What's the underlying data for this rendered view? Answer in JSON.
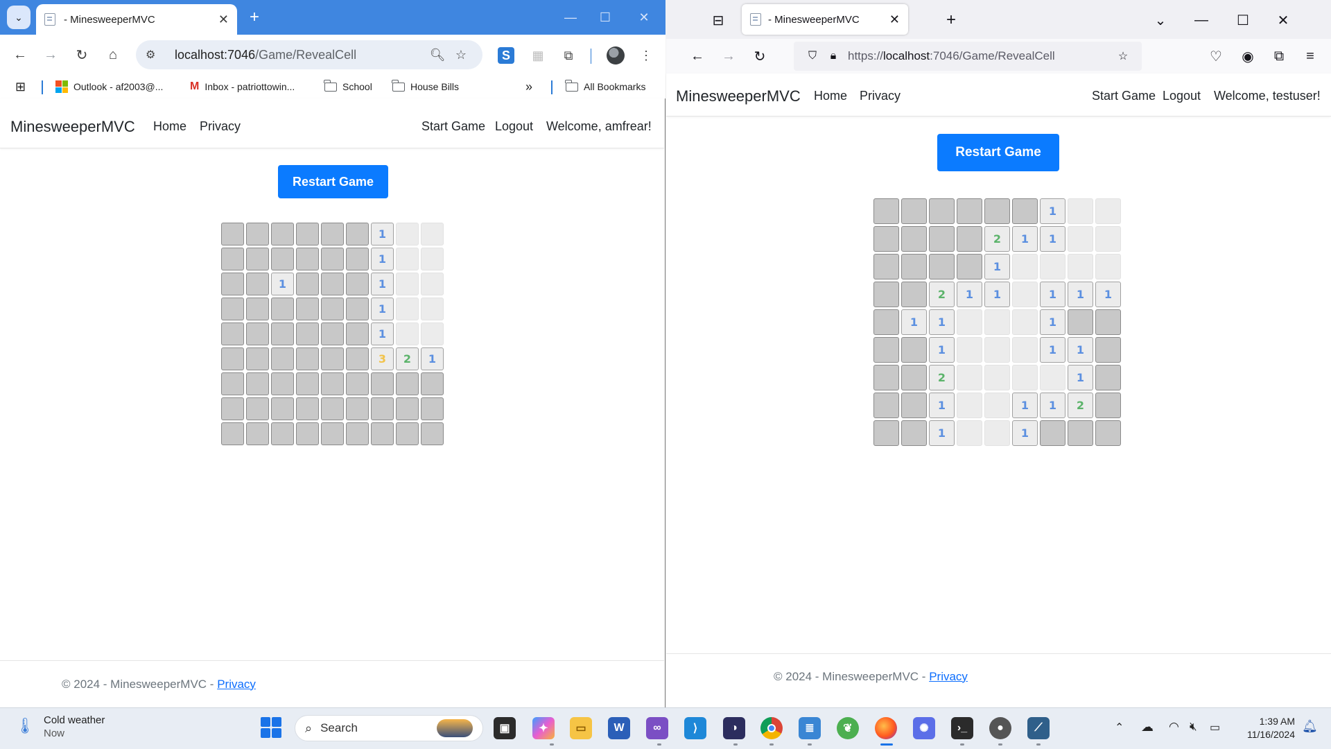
{
  "chrome": {
    "tab_title": "- MinesweeperMVC",
    "url_host": "localhost:7046",
    "url_path": "/Game/RevealCell",
    "bookmarks": [
      "Outlook - af2003@...",
      "Inbox - patriottowin...",
      "School",
      "House Bills",
      "All Bookmarks"
    ],
    "navbar": {
      "brand": "MinesweeperMVC",
      "home": "Home",
      "privacy": "Privacy",
      "start": "Start Game",
      "logout": "Logout",
      "welcome": "Welcome, amfrear!"
    },
    "restart_label": "Restart Game",
    "footer_text": "© 2024 - MinesweeperMVC - ",
    "footer_link": "Privacy",
    "board": [
      [
        "U",
        "U",
        "U",
        "U",
        "U",
        "U",
        "1",
        "R",
        "R"
      ],
      [
        "U",
        "U",
        "U",
        "U",
        "U",
        "U",
        "1",
        "R",
        "R"
      ],
      [
        "U",
        "U",
        "1",
        "U",
        "U",
        "U",
        "1",
        "R",
        "R"
      ],
      [
        "U",
        "U",
        "U",
        "U",
        "U",
        "U",
        "1",
        "R",
        "R"
      ],
      [
        "U",
        "U",
        "U",
        "U",
        "U",
        "U",
        "1",
        "R",
        "R"
      ],
      [
        "U",
        "U",
        "U",
        "U",
        "U",
        "U",
        "3",
        "2",
        "1"
      ],
      [
        "U",
        "U",
        "U",
        "U",
        "U",
        "U",
        "U",
        "U",
        "U"
      ],
      [
        "U",
        "U",
        "U",
        "U",
        "U",
        "U",
        "U",
        "U",
        "U"
      ],
      [
        "U",
        "U",
        "U",
        "U",
        "U",
        "U",
        "U",
        "U",
        "U"
      ]
    ]
  },
  "firefox": {
    "tab_title": "- MinesweeperMVC",
    "url_prefix": "https://",
    "url_host": "localhost",
    "url_rest": ":7046/Game/RevealCell",
    "navbar": {
      "brand": "MinesweeperMVC",
      "home": "Home",
      "privacy": "Privacy",
      "start": "Start Game",
      "logout": "Logout",
      "welcome": "Welcome, testuser!"
    },
    "restart_label": "Restart Game",
    "footer_text": "© 2024 - MinesweeperMVC - ",
    "footer_link": "Privacy",
    "board": [
      [
        "U",
        "U",
        "U",
        "U",
        "U",
        "U",
        "1",
        "R",
        "R"
      ],
      [
        "U",
        "U",
        "U",
        "U",
        "2",
        "1",
        "1",
        "R",
        "R"
      ],
      [
        "U",
        "U",
        "U",
        "U",
        "1",
        "R",
        "R",
        "R",
        "R"
      ],
      [
        "U",
        "U",
        "2",
        "1",
        "1",
        "R",
        "1",
        "1",
        "1"
      ],
      [
        "U",
        "1",
        "1",
        "R",
        "R",
        "R",
        "1",
        "U",
        "U"
      ],
      [
        "U",
        "U",
        "1",
        "R",
        "R",
        "R",
        "1",
        "1",
        "U"
      ],
      [
        "U",
        "U",
        "2",
        "R",
        "R",
        "R",
        "R",
        "1",
        "U"
      ],
      [
        "U",
        "U",
        "1",
        "R",
        "R",
        "1",
        "1",
        "2",
        "U"
      ],
      [
        "U",
        "U",
        "1",
        "R",
        "R",
        "1",
        "U",
        "U",
        "U"
      ]
    ]
  },
  "taskbar": {
    "weather_title": "Cold weather",
    "weather_sub": "Now",
    "search_placeholder": "Search",
    "time": "1:39 AM",
    "date": "11/16/2024"
  },
  "colors": {
    "one": "#5b8fe0",
    "two": "#5bb36a",
    "three": "#f2c34a",
    "restart_bg": "#0b7bff",
    "chrome_tabstrip": "#3f86e0"
  }
}
